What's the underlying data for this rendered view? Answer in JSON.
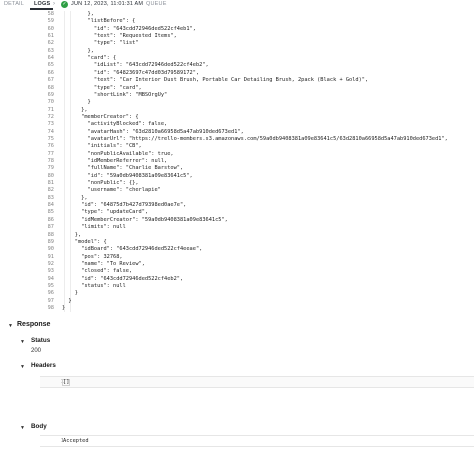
{
  "tabs": {
    "detail": "DETAIL",
    "logs": "LOGS",
    "timestamp": "JUN 12, 2023, 11:01:31 AM",
    "queue": "QUEUE"
  },
  "code_lines": [
    {
      "n": "58",
      "t": "        },"
    },
    {
      "n": "59",
      "t": "        \"listBefore\": {"
    },
    {
      "n": "60",
      "t": "          \"id\": \"643cdd72946ded522cf4eb1\","
    },
    {
      "n": "61",
      "t": "          \"text\": \"Requested Items\","
    },
    {
      "n": "62",
      "t": "          \"type\": \"list\""
    },
    {
      "n": "63",
      "t": "        },"
    },
    {
      "n": "64",
      "t": "        \"card\": {"
    },
    {
      "n": "65",
      "t": "          \"idList\": \"643cdd72946ded522cf4eb2\","
    },
    {
      "n": "66",
      "t": "          \"id\": \"64823697c47dd03d79589172\","
    },
    {
      "n": "67",
      "t": "          \"text\": \"Car Interior Dust Brush, Portable Car Detailing Brush, 2pack (Black + Gold)\","
    },
    {
      "n": "68",
      "t": "          \"type\": \"card\","
    },
    {
      "n": "69",
      "t": "          \"shortLink\": \"MBSOrgUy\""
    },
    {
      "n": "70",
      "t": "        }"
    },
    {
      "n": "71",
      "t": "      },"
    },
    {
      "n": "72",
      "t": "      \"memberCreator\": {"
    },
    {
      "n": "73",
      "t": "        \"activityBlocked\": false,"
    },
    {
      "n": "74",
      "t": "        \"avatarHash\": \"63d2810a66958d5a47ab910ded673ed1\","
    },
    {
      "n": "75",
      "t": "        \"avatarUrl\": \"https://trello-members.s3.amazonaws.com/59a0db9408381a09e83641c5/63d2810a66958d5a47ab910ded673ed1\","
    },
    {
      "n": "76",
      "t": "        \"initials\": \"CB\","
    },
    {
      "n": "77",
      "t": "        \"nonPublicAvailable\": true,"
    },
    {
      "n": "78",
      "t": "        \"idMemberReferrer\": null,"
    },
    {
      "n": "79",
      "t": "        \"fullName\": \"Charlie Barstow\","
    },
    {
      "n": "80",
      "t": "        \"id\": \"59a0db9408381a09e83641c5\","
    },
    {
      "n": "81",
      "t": "        \"nonPublic\": {},"
    },
    {
      "n": "82",
      "t": "        \"username\": \"cherlapie\""
    },
    {
      "n": "83",
      "t": "      },"
    },
    {
      "n": "84",
      "t": "      \"id\": \"64875d7b427d79398ed0ae7e\","
    },
    {
      "n": "85",
      "t": "      \"type\": \"updateCard\","
    },
    {
      "n": "86",
      "t": "      \"idMemberCreator\": \"59a0db9408381a09e83641c5\","
    },
    {
      "n": "87",
      "t": "      \"limits\": null"
    },
    {
      "n": "88",
      "t": "    },"
    },
    {
      "n": "89",
      "t": "    \"model\": {"
    },
    {
      "n": "90",
      "t": "      \"idBoard\": \"643cdd72946ded522cf4eeae\","
    },
    {
      "n": "91",
      "t": "      \"pos\": 32768,"
    },
    {
      "n": "92",
      "t": "      \"name\": \"To Review\","
    },
    {
      "n": "93",
      "t": "      \"closed\": false,"
    },
    {
      "n": "94",
      "t": "      \"id\": \"643cdd72946ded522cf4eb2\","
    },
    {
      "n": "95",
      "t": "      \"status\": null"
    },
    {
      "n": "96",
      "t": "    }"
    },
    {
      "n": "97",
      "t": "  }"
    },
    {
      "n": "98",
      "t": "}"
    }
  ],
  "response": {
    "title": "Response",
    "status_label": "Status",
    "status_value": "200",
    "headers_label": "Headers",
    "headers_line": "1",
    "headers_value": "[]",
    "body_label": "Body",
    "body_line": "1",
    "body_value": "Accepted"
  },
  "colors": {
    "success": "#2e9e44",
    "line_number": "#858585"
  }
}
